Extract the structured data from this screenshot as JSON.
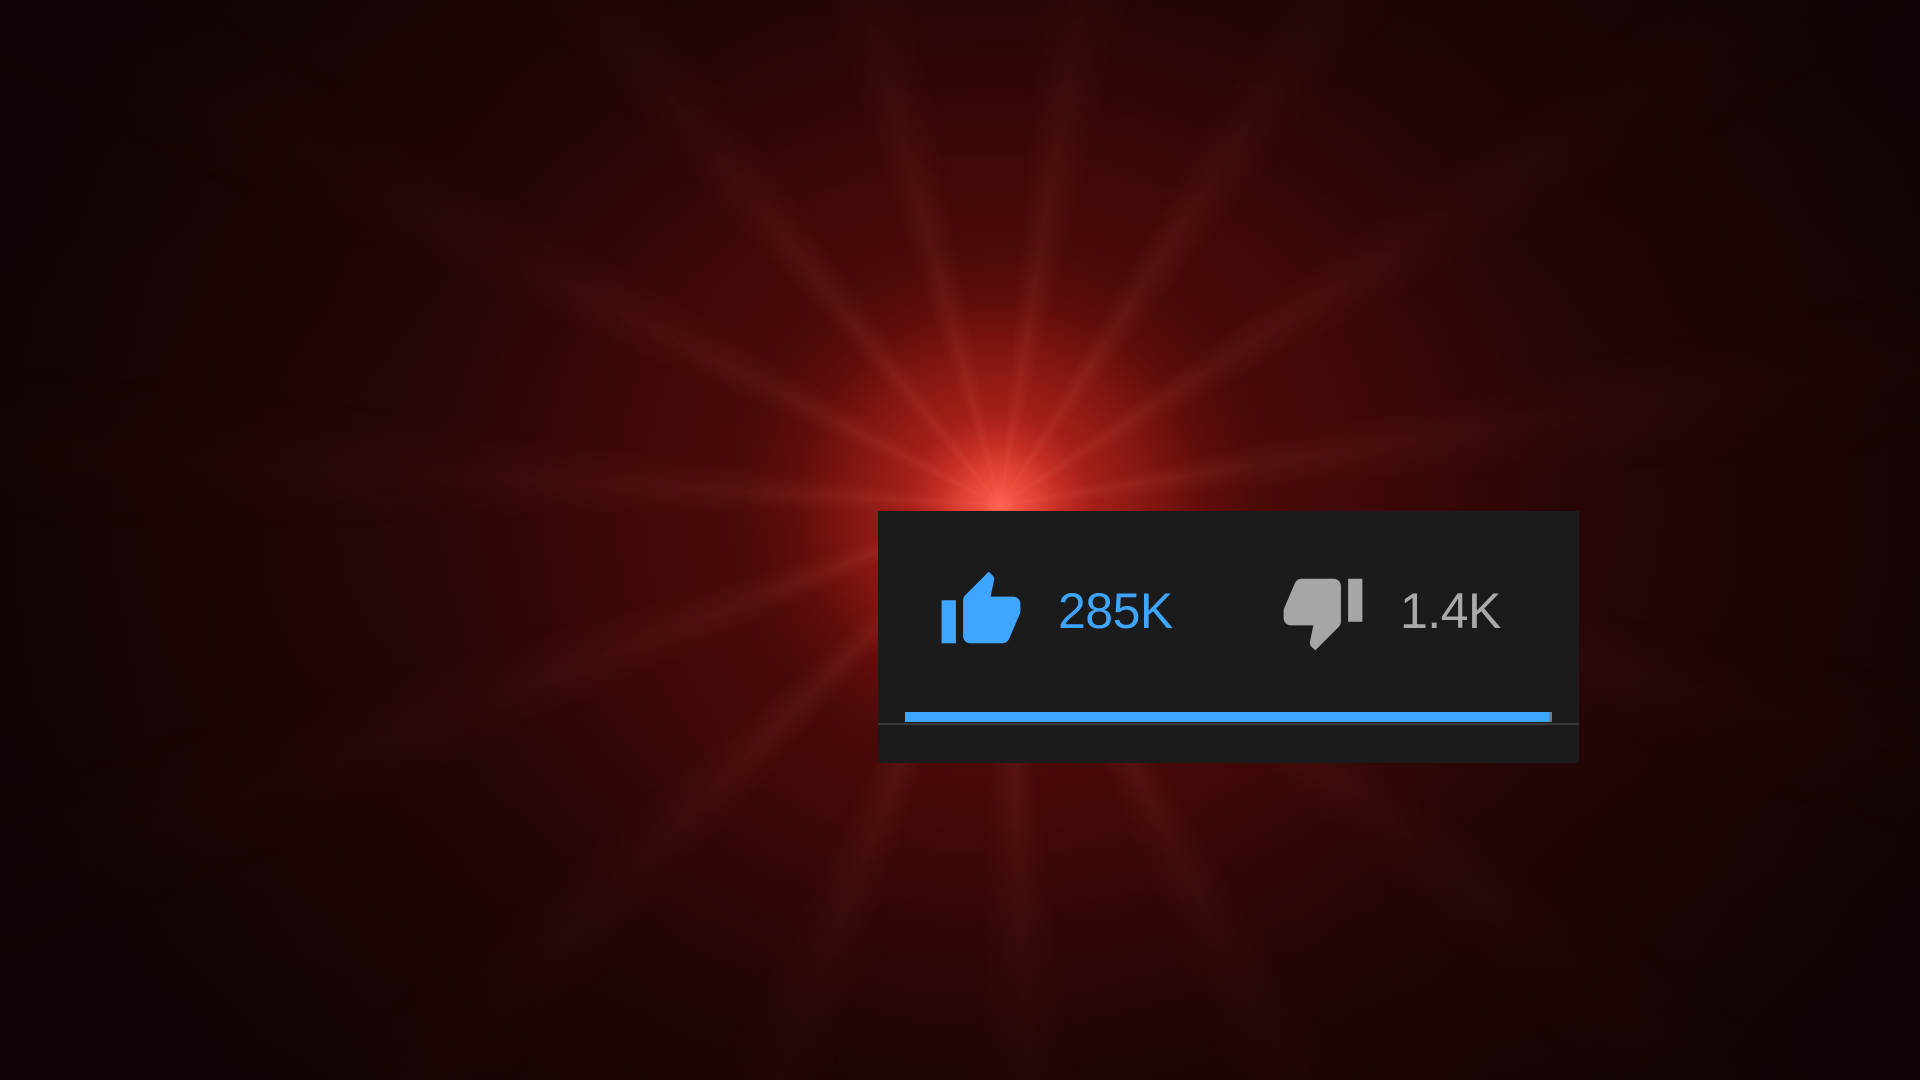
{
  "rating": {
    "likes": "285K",
    "dislikes": "1.4K",
    "like_fraction": 0.9951
  },
  "icons": {
    "like": "thumbs-up-icon",
    "dislike": "thumbs-down-icon"
  },
  "colors": {
    "like_accent": "#3ea6ff",
    "dislike_text": "#aaaaaa",
    "panel_background": "#1b1b1b"
  }
}
